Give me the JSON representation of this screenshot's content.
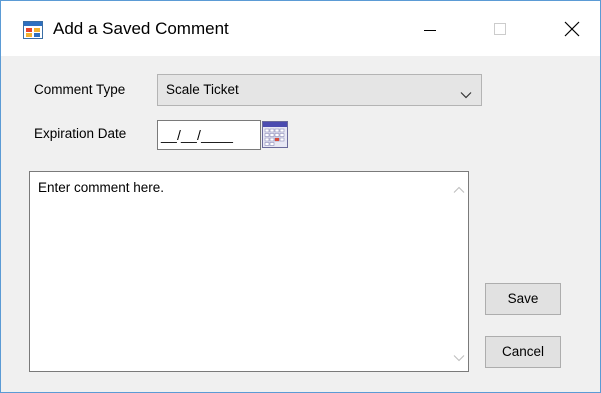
{
  "window": {
    "title": "Add a Saved Comment",
    "icon": "app-form-icon",
    "controls": {
      "minimize_icon": "minimize-icon",
      "maximize_icon": "maximize-icon",
      "close_icon": "close-icon"
    }
  },
  "form": {
    "comment_type": {
      "label": "Comment Type",
      "value": "Scale Ticket",
      "icon": "chevron-down-icon"
    },
    "expiration_date": {
      "label": "Expiration Date",
      "mask": "__/__/____",
      "icon": "calendar-icon"
    },
    "comment": {
      "text": "Enter comment here."
    }
  },
  "buttons": {
    "save_label": "Save",
    "cancel_label": "Cancel"
  },
  "colors": {
    "window_border": "#5b9bd5",
    "dialog_background": "#f0f0f0",
    "button_face": "#e1e1e1"
  }
}
